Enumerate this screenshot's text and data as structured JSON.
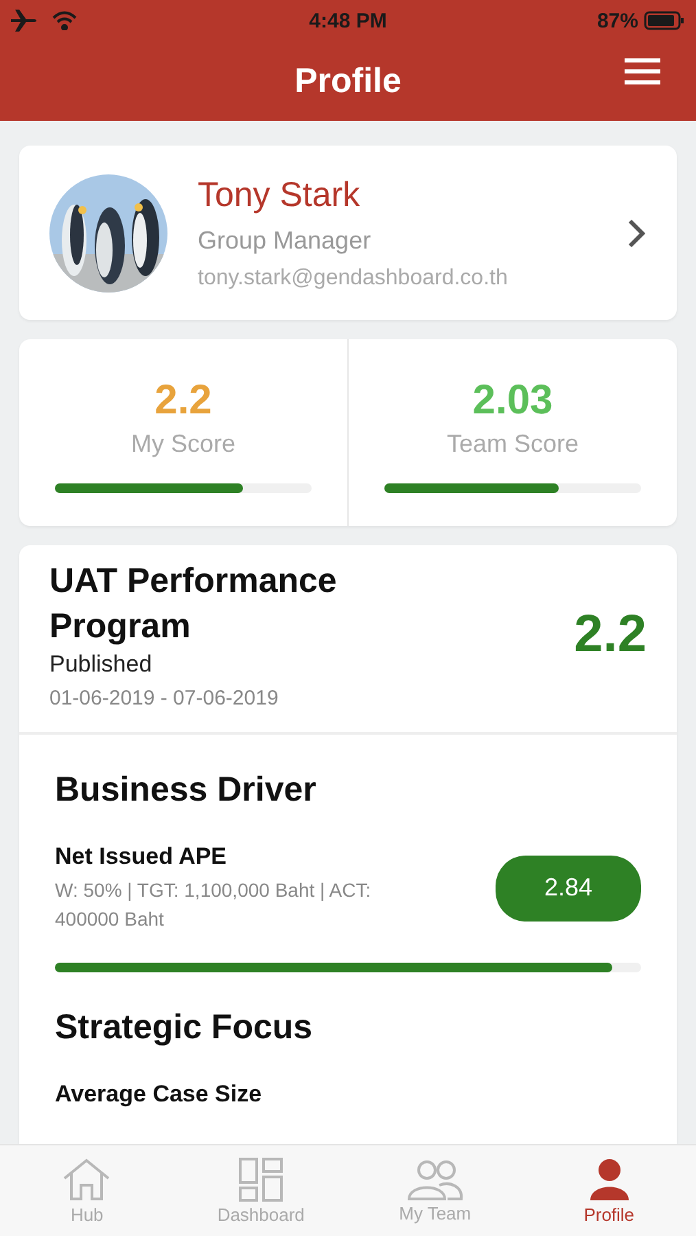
{
  "status_bar": {
    "time": "4:48 PM",
    "battery": "87%"
  },
  "header": {
    "title": "Profile"
  },
  "profile": {
    "name": "Tony Stark",
    "role": "Group Manager",
    "email": "tony.stark@gendashboard.co.th"
  },
  "scores": [
    {
      "value": "2.2",
      "label": "My Score",
      "color": "#e8a33c",
      "level": 0.73
    },
    {
      "value": "2.03",
      "label": "Team Score",
      "color": "#5cbf5a",
      "level": 0.68
    }
  ],
  "program": {
    "title": "UAT Performance Program",
    "status": "Published",
    "period": "01-06-2019 - 07-06-2019",
    "score": "2.2"
  },
  "sections": [
    {
      "title": "Business Driver",
      "items": [
        {
          "name": "Net Issued APE",
          "detail": "W: 50% | TGT: 1,100,000 Baht | ACT: 400000 Baht",
          "score": "2.84",
          "level": 0.95
        }
      ]
    },
    {
      "title": "Strategic Focus",
      "items": [
        {
          "name": "Average Case Size"
        }
      ]
    }
  ],
  "tabs": [
    {
      "label": "Hub",
      "kind": "home",
      "selected": false
    },
    {
      "label": "Dashboard",
      "kind": "dashboard",
      "selected": false
    },
    {
      "label": "My Team",
      "kind": "team",
      "selected": false
    },
    {
      "label": "Profile",
      "kind": "person",
      "selected": true
    }
  ]
}
